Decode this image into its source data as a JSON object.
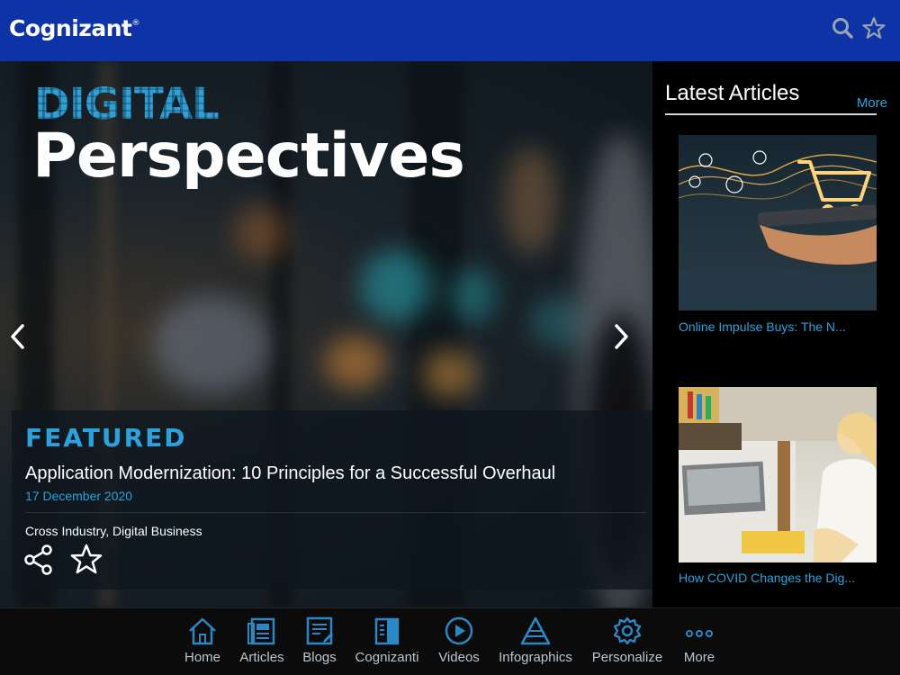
{
  "header": {
    "logo": "Cognizant",
    "logo_mark": "®",
    "icons": [
      "search-icon",
      "star-icon"
    ],
    "background_color": "#0d33a6"
  },
  "hero": {
    "title_line1": "DIGITAL",
    "title_line2": "Perspectives",
    "featured": {
      "label": "FEATURED",
      "title": "Application Modernization: 10 Principles for a Successful Overhaul",
      "date": "17 December 2020",
      "tags": "Cross Industry, Digital Business"
    },
    "accent_color": "#2aa3dc"
  },
  "sidebar": {
    "title": "Latest Articles",
    "more_label": "More",
    "articles": [
      {
        "caption": "Online Impulse Buys: The N..."
      },
      {
        "caption": "How COVID Changes the Dig..."
      }
    ]
  },
  "tabbar": {
    "tabs": [
      {
        "label": "Home",
        "icon": "home-icon"
      },
      {
        "label": "Articles",
        "icon": "articles-icon"
      },
      {
        "label": "Blogs",
        "icon": "blogs-icon"
      },
      {
        "label": "Cognizanti",
        "icon": "cognizanti-icon"
      },
      {
        "label": "Videos",
        "icon": "play-icon"
      },
      {
        "label": "Infographics",
        "icon": "pyramid-icon"
      },
      {
        "label": "Personalize",
        "icon": "gear-icon"
      },
      {
        "label": "More",
        "icon": "more-dots-icon"
      }
    ],
    "icon_color": "#2a89c4"
  }
}
